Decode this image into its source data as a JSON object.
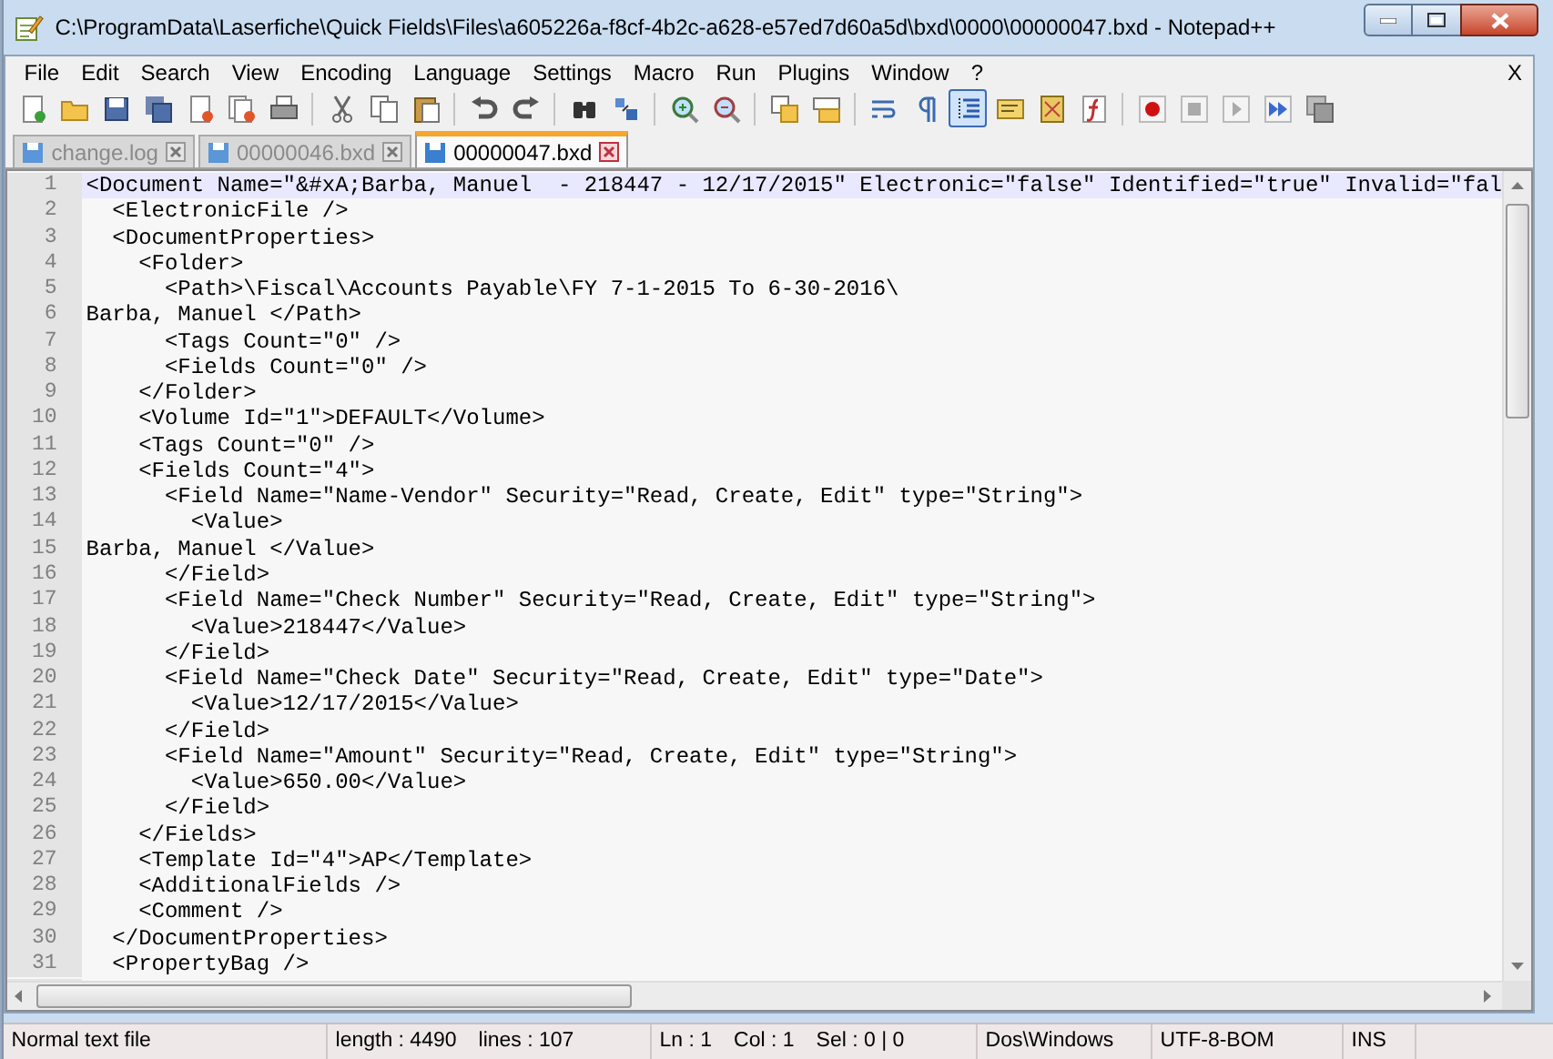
{
  "window": {
    "title": "C:\\ProgramData\\Laserfiche\\Quick Fields\\Files\\a605226a-f8cf-4b2c-a628-e57ed7d60a5d\\bxd\\0000\\00000047.bxd - Notepad++"
  },
  "menu": [
    "File",
    "Edit",
    "Search",
    "View",
    "Encoding",
    "Language",
    "Settings",
    "Macro",
    "Run",
    "Plugins",
    "Window",
    "?"
  ],
  "close_document": "X",
  "toolbar": [
    {
      "pressed": false
    },
    {
      "pressed": false
    },
    {
      "pressed": false
    },
    {
      "pressed": false
    },
    {
      "pressed": false
    },
    {
      "pressed": false
    },
    {
      "pressed": false
    },
    {
      "pressed": false
    },
    {
      "pressed": false
    },
    {
      "pressed": false
    },
    {
      "pressed": false
    },
    {
      "pressed": false
    },
    {
      "pressed": false
    },
    {
      "pressed": false
    },
    {
      "pressed": false
    },
    {
      "pressed": false
    },
    {
      "pressed": false
    },
    {
      "pressed": false
    },
    {
      "pressed": false
    },
    {
      "pressed": false
    },
    {
      "pressed": true
    },
    {
      "pressed": false
    },
    {
      "pressed": false
    },
    {
      "pressed": false
    },
    {
      "pressed": false
    },
    {
      "pressed": false
    },
    {
      "pressed": false
    },
    {
      "pressed": false
    },
    {
      "pressed": false
    }
  ],
  "tabs": [
    {
      "label": "change.log",
      "selected": false
    },
    {
      "label": "00000046.bxd",
      "selected": false
    },
    {
      "label": "00000047.bxd",
      "selected": true
    }
  ],
  "lines": [
    {
      "number": "1",
      "text": "<Document Name=\"&#xA;Barba, Manuel  - 218447 - 12/17/2015\" Electronic=\"false\" Identified=\"true\" Invalid=\"fal",
      "current": true
    },
    {
      "number": "2",
      "text": "  <ElectronicFile />",
      "current": false
    },
    {
      "number": "3",
      "text": "  <DocumentProperties>",
      "current": false
    },
    {
      "number": "4",
      "text": "    <Folder>",
      "current": false
    },
    {
      "number": "5",
      "text": "      <Path>\\Fiscal\\Accounts Payable\\FY 7-1-2015 To 6-30-2016\\",
      "current": false
    },
    {
      "number": "6",
      "text": "Barba, Manuel </Path>",
      "current": false
    },
    {
      "number": "7",
      "text": "      <Tags Count=\"0\" />",
      "current": false
    },
    {
      "number": "8",
      "text": "      <Fields Count=\"0\" />",
      "current": false
    },
    {
      "number": "9",
      "text": "    </Folder>",
      "current": false
    },
    {
      "number": "10",
      "text": "    <Volume Id=\"1\">DEFAULT</Volume>",
      "current": false
    },
    {
      "number": "11",
      "text": "    <Tags Count=\"0\" />",
      "current": false
    },
    {
      "number": "12",
      "text": "    <Fields Count=\"4\">",
      "current": false
    },
    {
      "number": "13",
      "text": "      <Field Name=\"Name-Vendor\" Security=\"Read, Create, Edit\" type=\"String\">",
      "current": false
    },
    {
      "number": "14",
      "text": "        <Value>",
      "current": false
    },
    {
      "number": "15",
      "text": "Barba, Manuel </Value>",
      "current": false
    },
    {
      "number": "16",
      "text": "      </Field>",
      "current": false
    },
    {
      "number": "17",
      "text": "      <Field Name=\"Check Number\" Security=\"Read, Create, Edit\" type=\"String\">",
      "current": false
    },
    {
      "number": "18",
      "text": "        <Value>218447</Value>",
      "current": false
    },
    {
      "number": "19",
      "text": "      </Field>",
      "current": false
    },
    {
      "number": "20",
      "text": "      <Field Name=\"Check Date\" Security=\"Read, Create, Edit\" type=\"Date\">",
      "current": false
    },
    {
      "number": "21",
      "text": "        <Value>12/17/2015</Value>",
      "current": false
    },
    {
      "number": "22",
      "text": "      </Field>",
      "current": false
    },
    {
      "number": "23",
      "text": "      <Field Name=\"Amount\" Security=\"Read, Create, Edit\" type=\"String\">",
      "current": false
    },
    {
      "number": "24",
      "text": "        <Value>650.00</Value>",
      "current": false
    },
    {
      "number": "25",
      "text": "      </Field>",
      "current": false
    },
    {
      "number": "26",
      "text": "    </Fields>",
      "current": false
    },
    {
      "number": "27",
      "text": "    <Template Id=\"4\">AP</Template>",
      "current": false
    },
    {
      "number": "28",
      "text": "    <AdditionalFields />",
      "current": false
    },
    {
      "number": "29",
      "text": "    <Comment />",
      "current": false
    },
    {
      "number": "30",
      "text": "  </DocumentProperties>",
      "current": false
    },
    {
      "number": "31",
      "text": "  <PropertyBag />",
      "current": false
    }
  ],
  "status_bar": {
    "file_type": "Normal text file",
    "length": "length : 4490",
    "lines": "lines : 107",
    "line": "Ln : 1",
    "column": "Col : 1",
    "selection": "Sel : 0 | 0",
    "eol": "Dos\\Windows",
    "encoding": "UTF-8-BOM",
    "mode": "INS"
  }
}
